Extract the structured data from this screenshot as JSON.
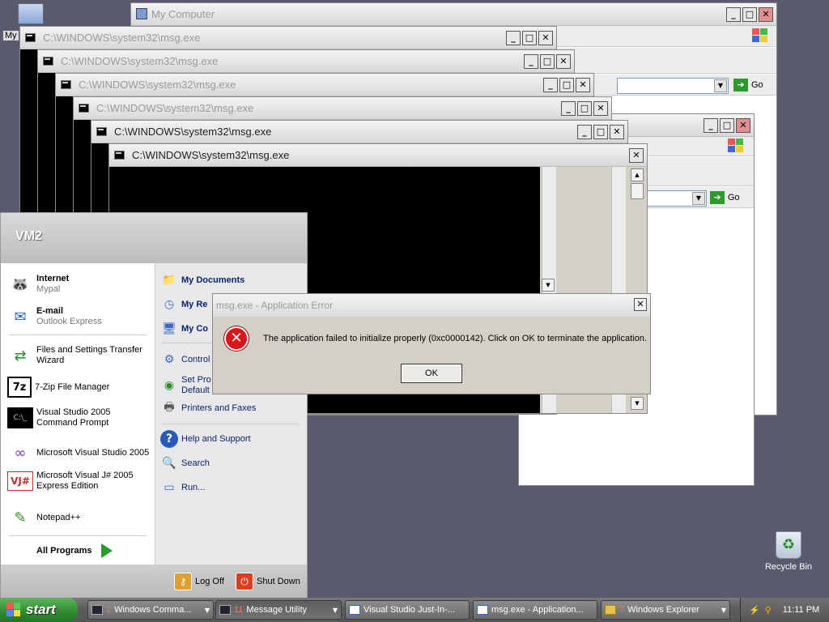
{
  "desktop": {
    "mycomputer_label": "My",
    "recycle_bin": "Recycle Bin"
  },
  "explorer_back": {
    "title": "My Computer",
    "go": "Go"
  },
  "explorer_front": {
    "go": "Go"
  },
  "console_windows": [
    "C:\\WINDOWS\\system32\\msg.exe",
    "C:\\WINDOWS\\system32\\msg.exe",
    "C:\\WINDOWS\\system32\\msg.exe",
    "C:\\WINDOWS\\system32\\msg.exe",
    "C:\\WINDOWS\\system32\\msg.exe",
    "C:\\WINDOWS\\system32\\msg.exe"
  ],
  "start_menu": {
    "user": "VM2",
    "left_items": [
      {
        "title": "Internet",
        "sub": "Mypal"
      },
      {
        "title": "E-mail",
        "sub": "Outlook Express"
      },
      {
        "title": "Files and Settings Transfer Wizard"
      },
      {
        "title": "7-Zip File Manager"
      },
      {
        "title": "Visual Studio 2005 Command Prompt"
      },
      {
        "title": "Microsoft Visual Studio 2005"
      },
      {
        "title": "Microsoft Visual J# 2005 Express Edition"
      },
      {
        "title": "Notepad++"
      }
    ],
    "all_programs": "All Programs",
    "right_items": [
      "My Documents",
      "My Re",
      "My Co",
      "Control",
      "Set Pro",
      "Default",
      "Printers and Faxes",
      "Help and Support",
      "Search",
      "Run..."
    ],
    "log_off": "Log Off",
    "shut_down": "Shut Down"
  },
  "dialog": {
    "title": "msg.exe - Application Error",
    "message": "The application failed to initialize properly (0xc0000142). Click on OK to terminate the application.",
    "ok": "OK"
  },
  "taskbar": {
    "start": "start",
    "buttons": [
      {
        "num": "2",
        "label": "Windows Comma..."
      },
      {
        "num": "11",
        "label": "Message Utility"
      },
      {
        "num": "",
        "label": "Visual Studio Just-In-..."
      },
      {
        "num": "",
        "label": "msg.exe - Application..."
      },
      {
        "num": "7",
        "label": "Windows Explorer"
      }
    ],
    "clock": "11:11 PM"
  },
  "colors": {
    "desktop": "#5a5a6e",
    "error_red": "#d81818",
    "start_green": "#2d8a2d",
    "link_blue": "#0a246a"
  }
}
